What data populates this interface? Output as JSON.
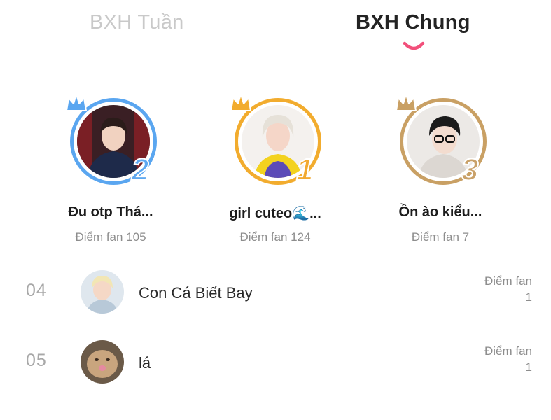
{
  "tabs": [
    {
      "label": "BXH Tuần",
      "active": false
    },
    {
      "label": "BXH Chung",
      "active": true
    }
  ],
  "score_label": "Điểm fan",
  "podium": [
    {
      "rank": "2",
      "name": "Đu otp Thá...",
      "score_text": "Điểm fan 105",
      "medal": "silver"
    },
    {
      "rank": "1",
      "name": "girl cuteo🌊...",
      "score_text": "Điểm fan 124",
      "medal": "gold"
    },
    {
      "rank": "3",
      "name": "Ồn ào kiểu...",
      "score_text": "Điểm fan 7",
      "medal": "bronze"
    }
  ],
  "list": [
    {
      "rank": "04",
      "name": "Con Cá Biết Bay",
      "score_label": "Điểm fan",
      "score": "1"
    },
    {
      "rank": "05",
      "name": "lá",
      "score_label": "Điểm fan",
      "score": "1"
    }
  ],
  "colors": {
    "accent": "#f2507b",
    "silver": "#5aa6f0",
    "gold": "#f2ac2e",
    "bronze": "#c9a064"
  },
  "icons": {
    "crown": "crown-icon",
    "underline": "smile-underline-icon"
  }
}
